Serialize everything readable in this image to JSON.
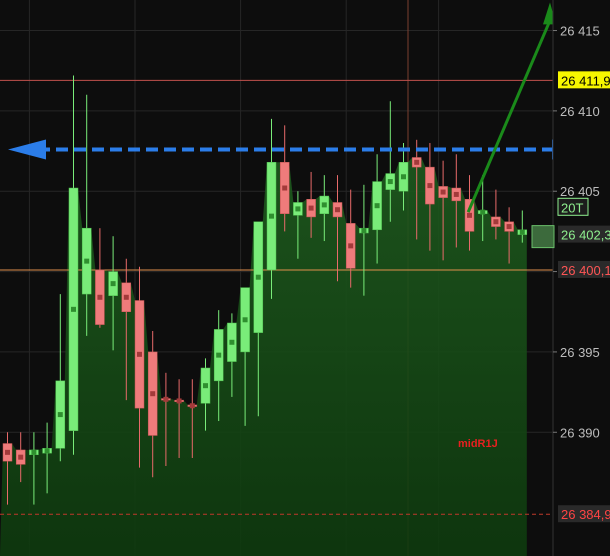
{
  "chart_data": {
    "type": "candlestick",
    "title": "",
    "xlabel": "",
    "ylabel": "",
    "ylim": [
      26382.3,
      26416.9
    ],
    "grid": true,
    "y_ticks": [
      26415,
      26410,
      26405,
      26400,
      26395,
      26390
    ],
    "y_tick_labels": [
      "26 415",
      "26 410",
      "26 405",
      "26 400",
      "26 395",
      "26 390"
    ],
    "price_labels": [
      {
        "name": "high-line",
        "text": "26 411,9",
        "value": 26411.9,
        "color": "#f7f700",
        "textColor": "#000000"
      },
      {
        "name": "last-price",
        "text": "26 402,3",
        "value": 26402.3,
        "color": "#2a2a2a",
        "textColor": "#8ff08f"
      },
      {
        "name": "low-line",
        "text": "26 400,1",
        "value": 26400.1,
        "color": "#2a2a2a",
        "textColor": "#ff5555"
      },
      {
        "name": "support-line",
        "text": "26 384,9",
        "value": 26384.9,
        "color": "#2a2a2a",
        "textColor": "#ff4444"
      }
    ],
    "timeframe_label": "20T",
    "annotation": "midR1J",
    "horizontal_lines": [
      {
        "name": "high-line",
        "value": 26411.9,
        "color": "#c0504d",
        "style": "solid"
      },
      {
        "name": "low-line",
        "value": 26400.1,
        "color": "#e0904d",
        "style": "solid"
      },
      {
        "name": "support-line",
        "value": 26384.9,
        "color": "#c0392b",
        "style": "dashed"
      }
    ],
    "blue_arrow_level": 26407.6,
    "green_arrow": {
      "from_index": 34.9,
      "from_value": 26403.7,
      "to_value": 26416.5
    },
    "candles": [
      {
        "o": 26389.3,
        "h": 26390.0,
        "l": 26385.5,
        "c": 26388.2
      },
      {
        "o": 26388.9,
        "h": 26390.0,
        "l": 26386.9,
        "c": 26388.0
      },
      {
        "o": 26388.6,
        "h": 26390.0,
        "l": 26385.5,
        "c": 26388.9
      },
      {
        "o": 26388.7,
        "h": 26390.6,
        "l": 26386.2,
        "c": 26389.0
      },
      {
        "o": 26389.0,
        "h": 26398.6,
        "l": 26388.2,
        "c": 26393.2
      },
      {
        "o": 26390.1,
        "h": 26412.2,
        "l": 26388.6,
        "c": 26405.2
      },
      {
        "o": 26398.6,
        "h": 26411.0,
        "l": 26396.0,
        "c": 26402.7
      },
      {
        "o": 26400.1,
        "h": 26402.7,
        "l": 26396.5,
        "c": 26396.7
      },
      {
        "o": 26398.5,
        "h": 26402.2,
        "l": 26395.1,
        "c": 26400.0
      },
      {
        "o": 26399.3,
        "h": 26400.8,
        "l": 26392.0,
        "c": 26397.5
      },
      {
        "o": 26398.2,
        "h": 26400.3,
        "l": 26387.8,
        "c": 26391.5
      },
      {
        "o": 26395.0,
        "h": 26396.3,
        "l": 26387.2,
        "c": 26389.8
      },
      {
        "o": 26392.1,
        "h": 26393.7,
        "l": 26387.9,
        "c": 26392.0
      },
      {
        "o": 26392.0,
        "h": 26393.3,
        "l": 26388.4,
        "c": 26391.9
      },
      {
        "o": 26391.7,
        "h": 26393.3,
        "l": 26388.4,
        "c": 26391.6
      },
      {
        "o": 26391.8,
        "h": 26394.6,
        "l": 26390.1,
        "c": 26394.0
      },
      {
        "o": 26393.2,
        "h": 26397.6,
        "l": 26390.7,
        "c": 26396.4
      },
      {
        "o": 26394.4,
        "h": 26397.4,
        "l": 26392.2,
        "c": 26396.8
      },
      {
        "o": 26395.0,
        "h": 26398.5,
        "l": 26390.4,
        "c": 26399.0
      },
      {
        "o": 26396.2,
        "h": 26402.3,
        "l": 26391.0,
        "c": 26403.1
      },
      {
        "o": 26400.1,
        "h": 26409.5,
        "l": 26398.3,
        "c": 26406.8
      },
      {
        "o": 26406.8,
        "h": 26409.1,
        "l": 26402.5,
        "c": 26403.6
      },
      {
        "o": 26403.5,
        "h": 26405.0,
        "l": 26400.8,
        "c": 26404.3
      },
      {
        "o": 26404.5,
        "h": 26406.2,
        "l": 26402.1,
        "c": 26403.4
      },
      {
        "o": 26403.6,
        "h": 26406.0,
        "l": 26401.9,
        "c": 26404.7
      },
      {
        "o": 26404.3,
        "h": 26406.0,
        "l": 26399.4,
        "c": 26403.4
      },
      {
        "o": 26403.0,
        "h": 26405.1,
        "l": 26399.0,
        "c": 26400.2
      },
      {
        "o": 26402.4,
        "h": 26405.4,
        "l": 26398.5,
        "c": 26402.7
      },
      {
        "o": 26402.6,
        "h": 26407.3,
        "l": 26400.5,
        "c": 26405.6
      },
      {
        "o": 26405.1,
        "h": 26410.6,
        "l": 26403.1,
        "c": 26406.1
      },
      {
        "o": 26405.0,
        "h": 26408.0,
        "l": 26403.8,
        "c": 26406.8
      },
      {
        "o": 26407.1,
        "h": 26408.2,
        "l": 26402.0,
        "c": 26406.5
      },
      {
        "o": 26406.5,
        "h": 26408.0,
        "l": 26401.3,
        "c": 26404.2
      },
      {
        "o": 26405.3,
        "h": 26406.9,
        "l": 26400.7,
        "c": 26404.6
      },
      {
        "o": 26405.2,
        "h": 26407.3,
        "l": 26401.5,
        "c": 26404.4
      },
      {
        "o": 26404.5,
        "h": 26406.0,
        "l": 26401.3,
        "c": 26402.5
      },
      {
        "o": 26403.6,
        "h": 26406.0,
        "l": 26401.9,
        "c": 26403.8
      },
      {
        "o": 26403.4,
        "h": 26405.1,
        "l": 26402.0,
        "c": 26402.8
      },
      {
        "o": 26403.1,
        "h": 26404.0,
        "l": 26400.5,
        "c": 26402.5
      },
      {
        "o": 26402.3,
        "h": 26403.8,
        "l": 26401.8,
        "c": 26402.6
      }
    ]
  }
}
